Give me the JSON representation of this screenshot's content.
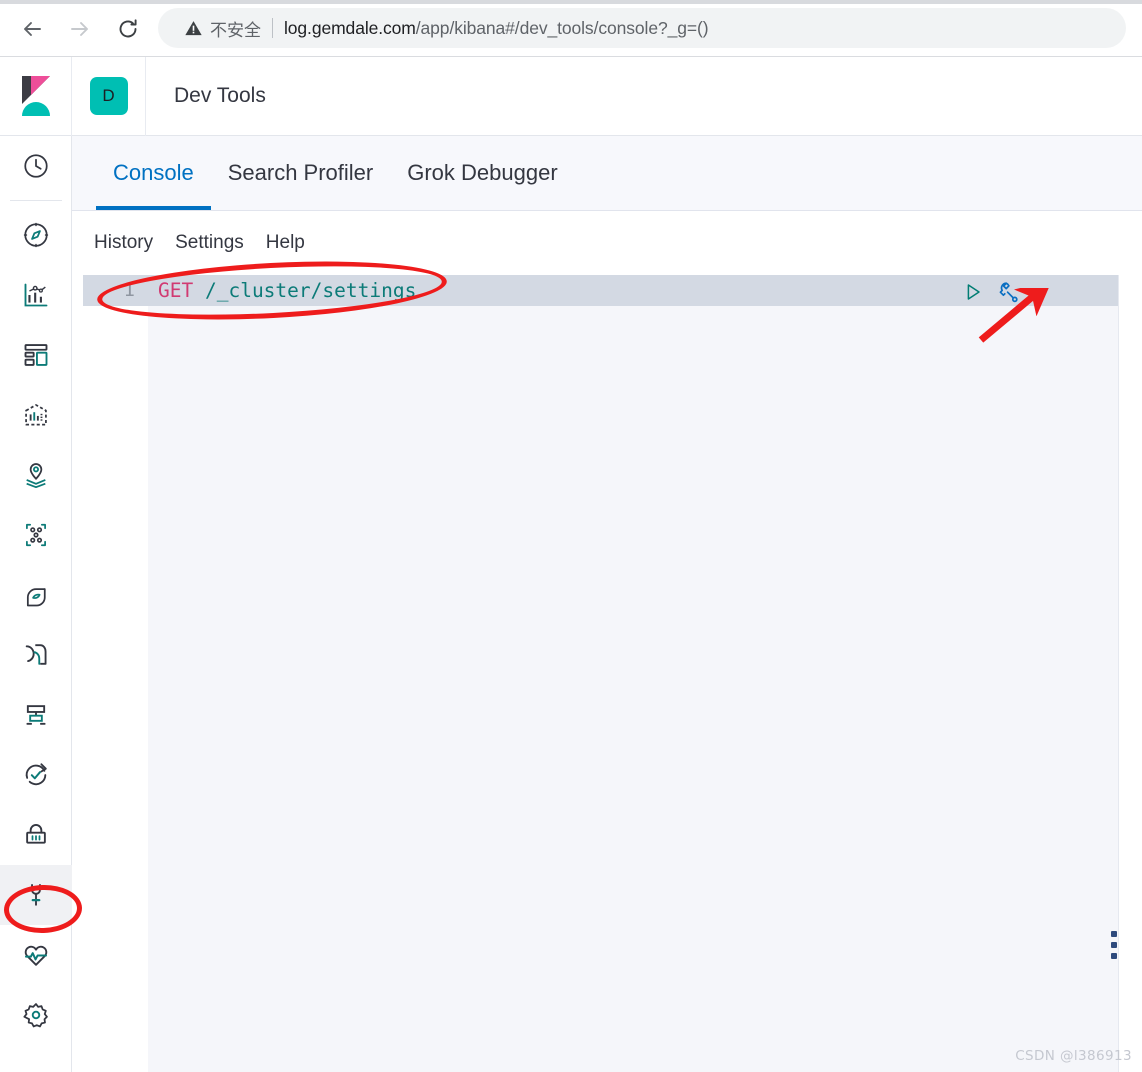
{
  "browser": {
    "back_icon": "arrow-left-icon",
    "forward_icon": "arrow-right-icon",
    "reload_icon": "reload-icon",
    "warning_icon": "warning-triangle-icon",
    "not_secure_label": "不安全",
    "url_host": "log.gemdale.com",
    "url_path": "/app/kibana#/dev_tools/console?_g=()",
    "url_full": "log.gemdale.com/app/kibana#/dev_tools/console?_g=()"
  },
  "header": {
    "logo_icon": "kibana-logo-icon",
    "app_badge_letter": "D",
    "app_title": "Dev Tools",
    "badge_color": "#00BFB3"
  },
  "sidebar": {
    "items": [
      {
        "icon": "clock-icon",
        "label": "Recently viewed",
        "active": false
      },
      {
        "icon": "compass-icon",
        "label": "Discover",
        "active": false
      },
      {
        "icon": "visualize-icon",
        "label": "Visualize",
        "active": false
      },
      {
        "icon": "dashboard-icon",
        "label": "Dashboard",
        "active": false
      },
      {
        "icon": "canvas-icon",
        "label": "Canvas",
        "active": false
      },
      {
        "icon": "maps-icon",
        "label": "Maps",
        "active": false
      },
      {
        "icon": "graph-icon",
        "label": "Graph",
        "active": false
      },
      {
        "icon": "machine-learning-icon",
        "label": "Machine Learning",
        "active": false
      },
      {
        "icon": "apm-icon",
        "label": "APM",
        "active": false
      },
      {
        "icon": "logs-icon",
        "label": "Logs",
        "active": false
      },
      {
        "icon": "uptime-icon",
        "label": "Uptime",
        "active": false
      },
      {
        "icon": "lock-icon",
        "label": "SIEM",
        "active": false
      },
      {
        "icon": "wrench-icon",
        "label": "Dev Tools",
        "active": true
      },
      {
        "icon": "heartbeat-icon",
        "label": "Monitoring",
        "active": false
      },
      {
        "icon": "gear-icon",
        "label": "Management",
        "active": false
      }
    ]
  },
  "main": {
    "tabs": [
      {
        "label": "Console",
        "active": true
      },
      {
        "label": "Search Profiler",
        "active": false
      },
      {
        "label": "Grok Debugger",
        "active": false
      }
    ],
    "console": {
      "actions": [
        {
          "label": "History"
        },
        {
          "label": "Settings"
        },
        {
          "label": "Help"
        }
      ],
      "editor": {
        "line_number": "1",
        "method": "GET",
        "path": "/_cluster/settings",
        "full_text": "GET /_cluster/settings",
        "method_color": "#D13A72",
        "path_color": "#0C7B78"
      },
      "tools": [
        {
          "icon": "play-icon",
          "label": "Click to send request",
          "color": "#017d73"
        },
        {
          "icon": "wrench-icon",
          "label": "Open documentation",
          "color": "#0a6fc2"
        }
      ],
      "drag_handle_icon": "vertical-grip-icon"
    }
  },
  "annotations": {
    "accent_color": "#EE1C1C",
    "ellipse_code_target": "GET /_cluster/settings",
    "ellipse_sidebar_target": "Dev Tools",
    "arrow_target": "play-icon"
  },
  "watermark": {
    "text": "CSDN @l386913"
  }
}
